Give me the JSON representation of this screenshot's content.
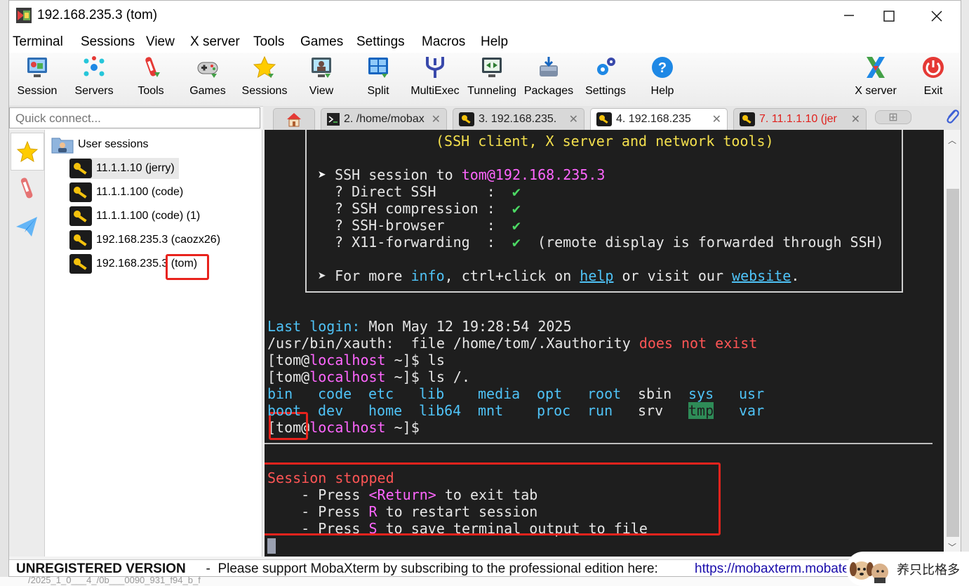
{
  "window": {
    "title": "192.168.235.3 (tom)"
  },
  "menu": [
    "Terminal",
    "Sessions",
    "View",
    "X server",
    "Tools",
    "Games",
    "Settings",
    "Macros",
    "Help"
  ],
  "toolbar": {
    "items": [
      {
        "label": "Session",
        "icon": "session-icon"
      },
      {
        "label": "Servers",
        "icon": "servers-icon"
      },
      {
        "label": "Tools",
        "icon": "tools-icon"
      },
      {
        "label": "Games",
        "icon": "games-icon"
      },
      {
        "label": "Sessions",
        "icon": "sessions-star-icon"
      },
      {
        "label": "View",
        "icon": "view-icon"
      },
      {
        "label": "Split",
        "icon": "split-icon"
      },
      {
        "label": "MultiExec",
        "icon": "multiexec-icon"
      },
      {
        "label": "Tunneling",
        "icon": "tunneling-icon"
      },
      {
        "label": "Packages",
        "icon": "packages-icon"
      },
      {
        "label": "Settings",
        "icon": "settings-icon"
      },
      {
        "label": "Help",
        "icon": "help-icon"
      }
    ],
    "xserver_label": "X server",
    "exit_label": "Exit"
  },
  "quick_connect": {
    "placeholder": "Quick connect..."
  },
  "sessions": {
    "root_label": "User sessions",
    "items": [
      "11.1.1.10 (jerry)",
      "11.1.1.100 (code)",
      "11.1.1.100 (code) (1)",
      "192.168.235.3 (caozx26)",
      "192.168.235.3 (tom)"
    ]
  },
  "tabs": [
    {
      "label": "2. /home/mobax",
      "color": "#222222"
    },
    {
      "label": "3. 192.168.235.",
      "color": "#222222"
    },
    {
      "label": "4. 192.168.235",
      "color": "#222222"
    },
    {
      "label": "7. 11.1.1.10 (jer",
      "color": "#e0201c"
    }
  ],
  "terminal": {
    "banner_subtitle": "(SSH client, X server and network tools)",
    "ssh_session_prefix": "SSH session to ",
    "ssh_session_target": "tom@192.168.235.3",
    "checks": [
      {
        "label": "? Direct SSH      :",
        "mark": "✔",
        "note": ""
      },
      {
        "label": "? SSH compression :",
        "mark": "✔",
        "note": ""
      },
      {
        "label": "? SSH-browser     :",
        "mark": "✔",
        "note": ""
      },
      {
        "label": "? X11-forwarding  :",
        "mark": "✔",
        "note": "(remote display is forwarded through SSH)"
      }
    ],
    "more_info": {
      "p1": "For more ",
      "info": "info",
      "p2": ", ctrl+click on ",
      "help": "help",
      "p3": " or visit our ",
      "website": "website",
      "p4": "."
    },
    "last_login_label": "Last login:",
    "last_login_value": " Mon May 12 19:28:54 2025",
    "xauth_line": "/usr/bin/xauth:  file /home/tom/.Xauthority ",
    "xauth_error": "does not exist",
    "prompt_user": "[tom@",
    "prompt_host": "localhost",
    "prompt_tail": " ~]$",
    "cmd1": " ls",
    "cmd2": " ls /.",
    "dirs_row1": [
      "bin",
      "code",
      "etc",
      "lib",
      "media",
      "opt",
      "root",
      "sbin",
      "sys",
      "usr"
    ],
    "dirs_row2": [
      "boot",
      "dev",
      "home",
      "lib64",
      "mnt",
      "proc",
      "run",
      "srv",
      "tmp",
      "var"
    ],
    "session_stopped": "Session stopped",
    "stop_lines": [
      {
        "pre": "    - Press ",
        "key": "<Return>",
        "post": " to exit tab"
      },
      {
        "pre": "    - Press ",
        "key": "R",
        "post": " to restart session"
      },
      {
        "pre": "    - Press ",
        "key": "S",
        "post": " to save terminal output to file"
      }
    ]
  },
  "statusbar": {
    "unregistered": "UNREGISTERED VERSION",
    "message": "  -  Please support MobaXterm by subscribing to the professional edition here:  ",
    "link": "https://mobaxterm.mobatek.net"
  },
  "watermark": "养只比格多",
  "background_snippet": "/2025_1_0___4_/0b___0090_931_f94_b_f"
}
